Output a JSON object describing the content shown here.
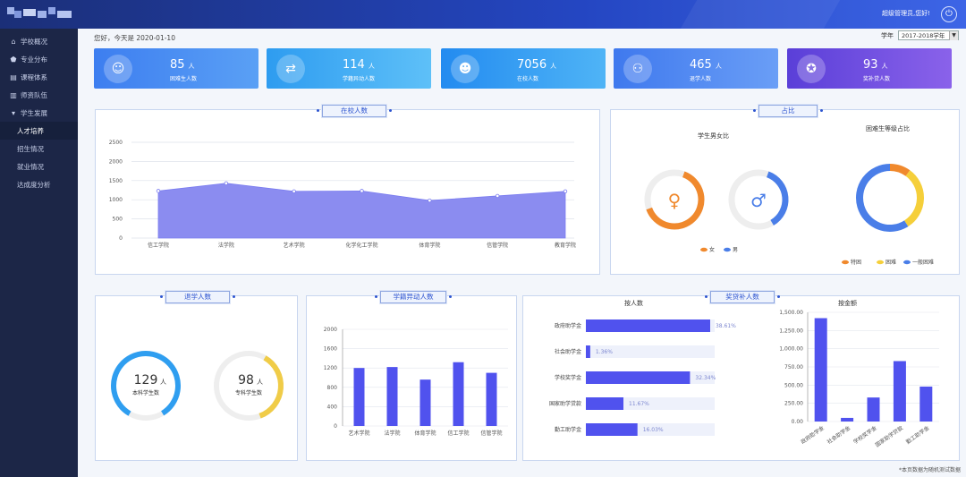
{
  "topbar": {
    "user_text": "超级管理员,您好!"
  },
  "sidebar": {
    "items": [
      {
        "label": "学校概况",
        "icon": "school-icon"
      },
      {
        "label": "专业分布",
        "icon": "graduation-cap-icon"
      },
      {
        "label": "课程体系",
        "icon": "book-icon"
      },
      {
        "label": "师资队伍",
        "icon": "faculty-icon"
      },
      {
        "label": "学生发展",
        "icon": "student-icon"
      }
    ],
    "subitems": [
      "人才培养",
      "招生情况",
      "就业情况",
      "达成度分析"
    ]
  },
  "header": {
    "greeting": "您好，今天是 2020-01-10",
    "year_label": "学年",
    "year_value": "2017-2018学年"
  },
  "cards": [
    {
      "value": "85",
      "unit": "人",
      "label": "困难生人数",
      "color": "#4f8ef2",
      "icon": "person-icon"
    },
    {
      "value": "114",
      "unit": "人",
      "label": "学籍异动人数",
      "color": "#3aa6f0",
      "icon": "transfer-icon"
    },
    {
      "value": "7056",
      "unit": "人",
      "label": "在校人数",
      "color": "#2e8ff0",
      "icon": "student-icon"
    },
    {
      "value": "465",
      "unit": "人",
      "label": "退学人数",
      "color": "#4a7ff0",
      "icon": "chair-icon"
    },
    {
      "value": "93",
      "unit": "人",
      "label": "奖补贷人数",
      "color": "#6a4fe0",
      "icon": "medal-icon"
    }
  ],
  "panels": {
    "enrolled": "在校人数",
    "ratio": "占比",
    "dropout": "退学人数",
    "status_change": "学籍异动人数",
    "aid": "奖贷补人数"
  },
  "ratio": {
    "gender_title": "学生男女比",
    "difficulty_title": "困难生等级占比",
    "female": "女",
    "male": "男",
    "levels": [
      "特困",
      "困难",
      "一般困难"
    ]
  },
  "dropout": {
    "undergrad_value": "129",
    "undergrad_unit": "人",
    "undergrad_label": "本科学生数",
    "junior_value": "98",
    "junior_unit": "人",
    "junior_label": "专科学生数"
  },
  "aid": {
    "count_title": "按人数",
    "amount_title": "按金额"
  },
  "footer_note": "*本页数据为随机测试数据",
  "colors": {
    "female": "#f0892d",
    "male": "#4a7ee8",
    "special": "#f0892d",
    "difficult": "#f5cf3a",
    "normal": "#4a7ee8",
    "bar": "#5052ee",
    "area": "#8b8cf0"
  },
  "chart_data": [
    {
      "type": "area",
      "title": "在校人数",
      "categories": [
        "信工学院",
        "法学院",
        "艺术学院",
        "化学化工学院",
        "体育学院",
        "信管学院",
        "教育学院"
      ],
      "values": [
        1230,
        1430,
        1220,
        1230,
        980,
        1100,
        1220
      ],
      "ylim": [
        0,
        2500
      ],
      "yticks": [
        0,
        500,
        1000,
        1500,
        2000,
        2500
      ]
    },
    {
      "type": "pie",
      "title": "学生男女比",
      "slices": [
        {
          "name": "女",
          "value": 64
        },
        {
          "name": "男",
          "value": 36
        }
      ]
    },
    {
      "type": "pie",
      "title": "困难生等级占比",
      "slices": [
        {
          "name": "特困",
          "value": 10
        },
        {
          "name": "困难",
          "value": 31
        },
        {
          "name": "一般困难",
          "value": 59
        }
      ]
    },
    {
      "type": "pie",
      "title": "退学人数",
      "series": [
        {
          "name": "本科学生数",
          "value": 129,
          "fraction": 0.83
        },
        {
          "name": "专科学生数",
          "value": 98,
          "fraction": 0.36
        }
      ]
    },
    {
      "type": "bar",
      "title": "学籍异动人数",
      "categories": [
        "艺术学院",
        "法学院",
        "体育学院",
        "信工学院",
        "信管学院"
      ],
      "values": [
        1200,
        1220,
        960,
        1320,
        1100
      ],
      "ylim": [
        0,
        2000
      ],
      "yticks": [
        0,
        400,
        800,
        1200,
        1600,
        2000
      ]
    },
    {
      "type": "bar",
      "title": "按人数",
      "orientation": "horizontal",
      "categories": [
        "政府助学金",
        "社会助学金",
        "学校奖学金",
        "国家助学贷款",
        "勤工助学金"
      ],
      "values": [
        38.61,
        1.36,
        32.34,
        11.67,
        16.03
      ],
      "labels": [
        "38.61%",
        "1.36%",
        "32.34%",
        "11.67%",
        "16.03%"
      ]
    },
    {
      "type": "bar",
      "title": "按金额",
      "categories": [
        "政府助学金",
        "社会助学金",
        "学校奖学金",
        "国家助学贷款",
        "勤工助学金"
      ],
      "values": [
        1420,
        50,
        330,
        830,
        480
      ],
      "ylim": [
        0,
        1500
      ],
      "yticks": [
        "0.00",
        "250.00",
        "500.00",
        "750.00",
        "1,000.00",
        "1,250.00",
        "1,500.00"
      ]
    }
  ]
}
